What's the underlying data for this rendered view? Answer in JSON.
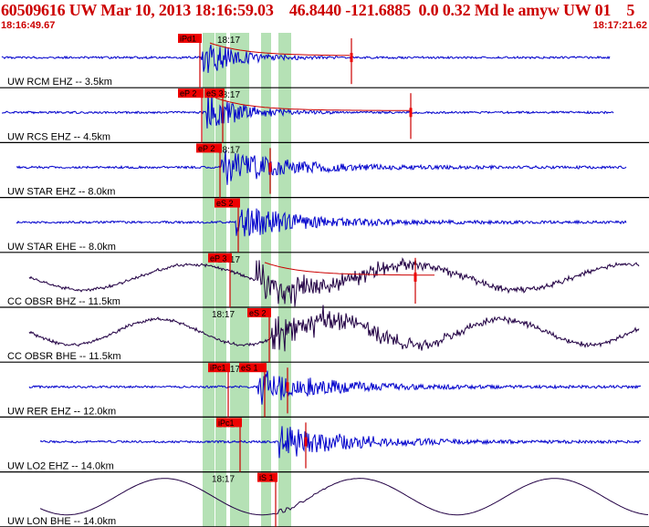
{
  "header": {
    "title": "60509616 UW Mar 10, 2013 18:16:59.03    46.8440 -121.6885  0.0 0.32 Md le amyw UW 01    5",
    "start_time": "18:16:49.67",
    "end_time": "18:17:21.62"
  },
  "colors": {
    "header_text": "#cc0000",
    "trace_short_period": "#0000cc",
    "trace_broadband": "#220044",
    "pick_box": "#ee0000",
    "pick_line": "#cc0000",
    "window_band": "#a8dca8",
    "coda_fit": "#cc0000"
  },
  "traces": [
    {
      "id": "rcm-ehz",
      "label": "UW RCM EHZ -- 3.5km",
      "type": "short",
      "time_label": "18:17",
      "picks": [
        {
          "label": "iPd1"
        }
      ],
      "coda": true
    },
    {
      "id": "rcs-ehz",
      "label": "UW RCS EHZ -- 4.5km",
      "type": "short",
      "time_label": "18:17",
      "picks": [
        {
          "label": "eP 2"
        },
        {
          "label": "eS 3"
        }
      ],
      "coda": true
    },
    {
      "id": "star-ehz",
      "label": "UW STAR EHZ -- 8.0km",
      "type": "short",
      "time_label": "18:17",
      "picks": [
        {
          "label": "eP 2"
        }
      ],
      "coda": false
    },
    {
      "id": "star-ehe",
      "label": "UW STAR EHE -- 8.0km",
      "type": "short",
      "time_label": "18:17",
      "picks": [
        {
          "label": "eS 2"
        }
      ],
      "coda": false
    },
    {
      "id": "obsr-bhz",
      "label": "CC OBSR BHZ -- 11.5km",
      "type": "broad",
      "time_label": "18:17",
      "picks": [
        {
          "label": "eP 3"
        }
      ],
      "coda": true
    },
    {
      "id": "obsr-bhe",
      "label": "CC OBSR BHE -- 11.5km",
      "type": "broad",
      "time_label": "18:17",
      "picks": [
        {
          "label": "eS 2"
        }
      ],
      "coda": false
    },
    {
      "id": "rer-ehz",
      "label": "UW RER EHZ -- 12.0km",
      "type": "short",
      "time_label": "18:17",
      "picks": [
        {
          "label": "iPc1"
        },
        {
          "label": "eS 1"
        }
      ],
      "coda": false
    },
    {
      "id": "lo2-ehz",
      "label": "UW LO2 EHZ -- 14.0km",
      "type": "short",
      "time_label": "18:17",
      "picks": [
        {
          "label": "iPc1"
        }
      ],
      "coda": false
    },
    {
      "id": "lon-bhe",
      "label": "UW LON BHE -- 14.0km",
      "type": "long",
      "time_label": "18:17",
      "picks": [
        {
          "label": "iS 1"
        }
      ],
      "coda": false
    }
  ]
}
